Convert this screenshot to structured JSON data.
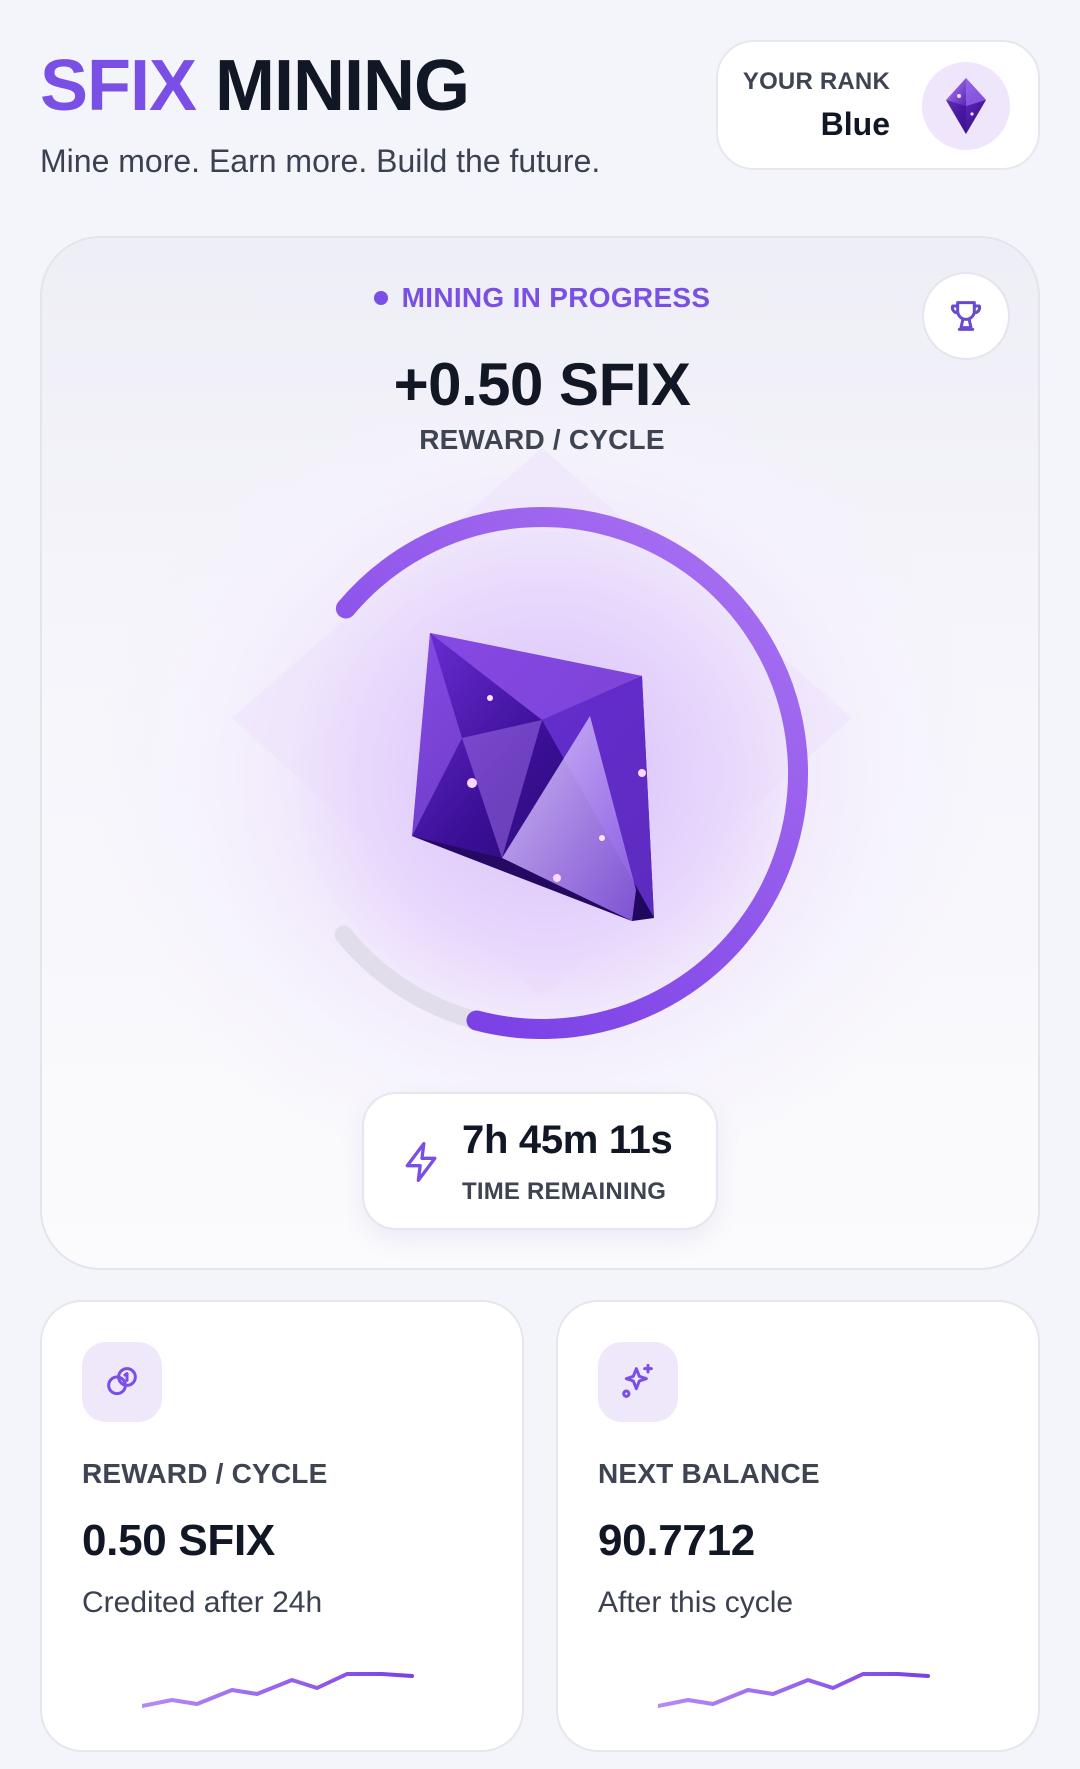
{
  "header": {
    "title_accent": "SFIX",
    "title_main": "MINING",
    "subtitle": "Mine more. Earn more. Build the future."
  },
  "rank": {
    "label": "YOUR RANK",
    "value": "Blue",
    "icon": "gem-icon"
  },
  "mining": {
    "status": "MINING IN PROGRESS",
    "reward_amount": "+0.50 SFIX",
    "reward_label": "REWARD / CYCLE",
    "progress_fraction": 0.68,
    "timer_value": "7h 45m 11s",
    "timer_label": "TIME REMAINING",
    "accent_color": "#7a4fe6",
    "trophy_icon": "trophy-icon",
    "timer_icon": "lightning-icon"
  },
  "stats": [
    {
      "icon": "coins-icon",
      "label": "REWARD / CYCLE",
      "value": "0.50 SFIX",
      "note": "Credited after 24h"
    },
    {
      "icon": "sparkles-icon",
      "label": "NEXT BALANCE",
      "value": "90.7712",
      "note": "After this cycle"
    }
  ]
}
